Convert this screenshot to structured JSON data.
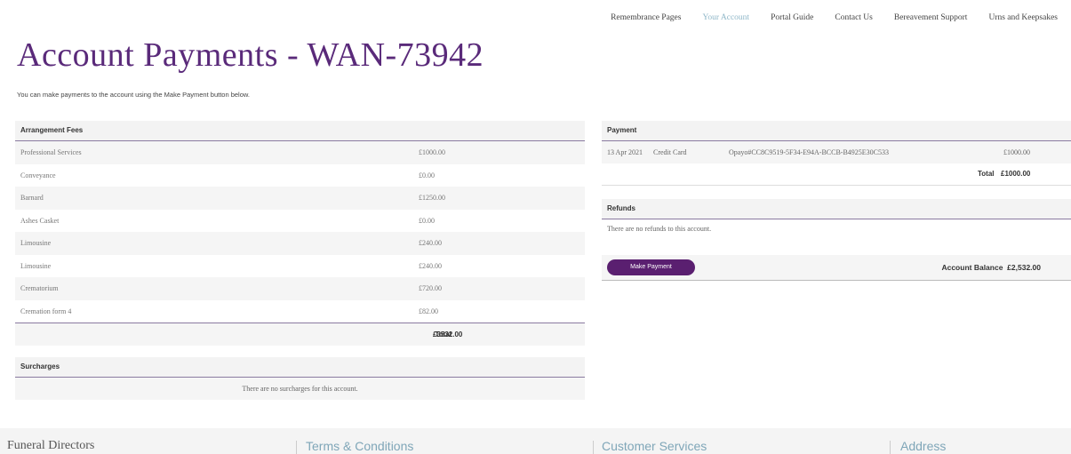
{
  "nav": {
    "items": [
      {
        "label": "Remembrance Pages"
      },
      {
        "label": "Your Account"
      },
      {
        "label": "Portal Guide"
      },
      {
        "label": "Contact Us"
      },
      {
        "label": "Bereavement Support"
      },
      {
        "label": "Urns and Keepsakes"
      }
    ],
    "active": "Your Account",
    "active_color": "#8fb7c8"
  },
  "page": {
    "title": "Account Payments - WAN-73942",
    "intro": "You can make payments to the account using the Make Payment button below."
  },
  "fees": {
    "header": "Arrangement Fees",
    "rows": [
      {
        "name": "Professional Services",
        "amount": "£1000.00"
      },
      {
        "name": "Conveyance",
        "amount": "£0.00"
      },
      {
        "name": "Barnard",
        "amount": "£1250.00"
      },
      {
        "name": "Ashes Casket",
        "amount": "£0.00"
      },
      {
        "name": "Limousine",
        "amount": "£240.00"
      },
      {
        "name": "Limousine",
        "amount": "£240.00"
      },
      {
        "name": "Crematorium",
        "amount": "£720.00"
      },
      {
        "name": "Cremation form 4",
        "amount": "£82.00"
      }
    ],
    "total_label": "Total",
    "total_value": "£3532.00"
  },
  "surcharges": {
    "header": "Surcharges",
    "empty": "There are no surcharges for this account."
  },
  "payment": {
    "header": "Payment",
    "rows": [
      {
        "date": "13 Apr 2021",
        "method": "Credit Card",
        "ref": "Opayo#CC8C9519-5F34-E94A-BCCB-B4925E30C533",
        "amount": "£1000.00"
      }
    ],
    "total_label": "Total",
    "total_value": "£1000.00"
  },
  "refunds": {
    "header": "Refunds",
    "empty": "There are no refunds to this account."
  },
  "actions": {
    "make_payment": "Make Payment",
    "balance_label": "Account Balance",
    "balance_value": "£2,532.00",
    "brand_color": "#5a1f70"
  },
  "footer": {
    "col1": "Funeral Directors",
    "col2": "Terms & Conditions",
    "col3": "Customer Services",
    "col4": "Address"
  }
}
